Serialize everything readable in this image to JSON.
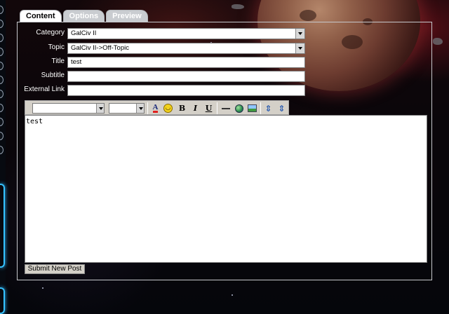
{
  "tabs": [
    {
      "label": "Content",
      "active": true
    },
    {
      "label": "Options",
      "active": false
    },
    {
      "label": "Preview",
      "active": false
    }
  ],
  "form": {
    "category": {
      "label": "Category",
      "value": "GalCiv II"
    },
    "topic": {
      "label": "Topic",
      "value": "GalCiv II->Off-Topic"
    },
    "title": {
      "label": "Title",
      "value": "test"
    },
    "subtitle": {
      "label": "Subtitle",
      "value": ""
    },
    "external_link": {
      "label": "External Link",
      "value": ""
    }
  },
  "toolbar": {
    "font_family_value": "",
    "font_size_value": "",
    "buttons": [
      {
        "name": "font-color-icon",
        "glyph": "A"
      },
      {
        "name": "smiley-icon",
        "glyph": "☺"
      },
      {
        "name": "bold-icon",
        "glyph": "B"
      },
      {
        "name": "italic-icon",
        "glyph": "I"
      },
      {
        "name": "underline-icon",
        "glyph": "U"
      },
      {
        "name": "horizontal-rule-icon",
        "glyph": "—"
      },
      {
        "name": "insert-link-icon",
        "glyph": "🌐"
      },
      {
        "name": "insert-image-icon",
        "glyph": "🖼"
      },
      {
        "name": "expand-icon",
        "glyph": "⇕"
      },
      {
        "name": "collapse-icon",
        "glyph": "⇕"
      }
    ]
  },
  "editor": {
    "text": "test"
  },
  "submit_label": "Submit New Post",
  "colors": {
    "accent_glow": "#36c3ff",
    "tab_inactive": "#c9ccd0",
    "font_color_bar": "#e02020"
  }
}
